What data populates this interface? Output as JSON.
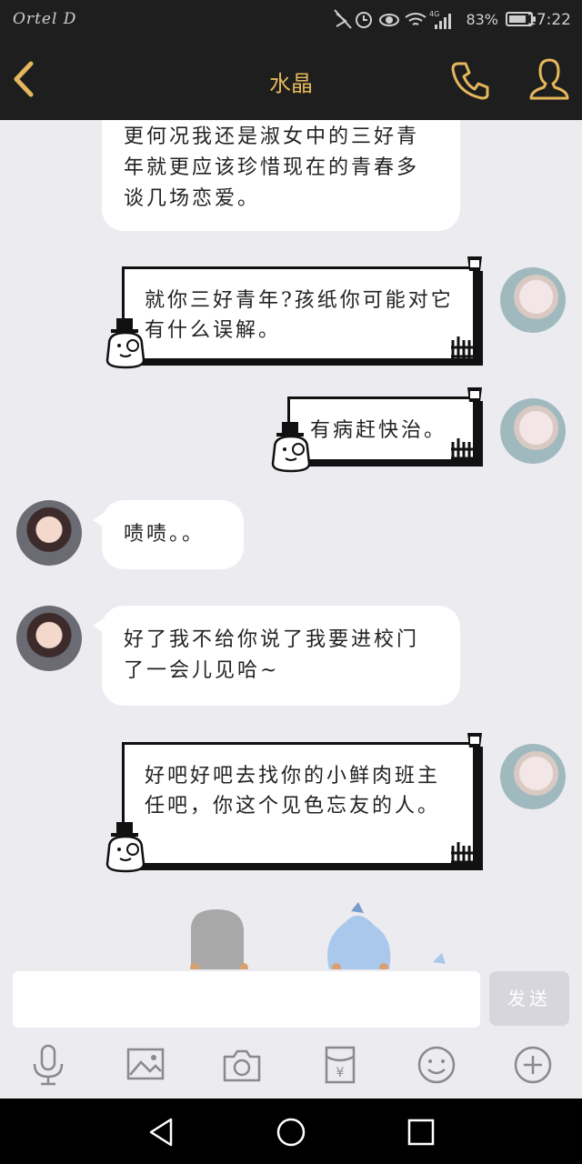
{
  "status_bar": {
    "carrier": "Ortel D",
    "battery": "83%",
    "battery_level": 0.83,
    "time": "17:22"
  },
  "header": {
    "title": "水晶"
  },
  "messages": [
    {
      "side": "left",
      "text": "更何况我还是淑女中的三好青年就更应该珍惜现在的青春多谈几场恋爱。"
    },
    {
      "side": "right",
      "text": "就你三好青年?孩纸你可能对它有什么误解。"
    },
    {
      "side": "right",
      "text": "有病赶快治。"
    },
    {
      "side": "left",
      "text": "啧啧。。"
    },
    {
      "side": "left",
      "text": "好了我不给你说了我要进校门了一会儿见哈~"
    },
    {
      "side": "right",
      "text": "好吧好吧去找你的小鲜肉班主任吧，你这个见色忘友的人。"
    }
  ],
  "composer": {
    "value": "",
    "send_label": "发送"
  },
  "colors": {
    "accent": "#e5b75c",
    "dark": "#1e1e1e",
    "chat_bg": "#ebebf0"
  },
  "toolbar_icons": [
    "microphone-icon",
    "image-icon",
    "camera-icon",
    "red-packet-icon",
    "emoji-icon",
    "plus-icon"
  ]
}
